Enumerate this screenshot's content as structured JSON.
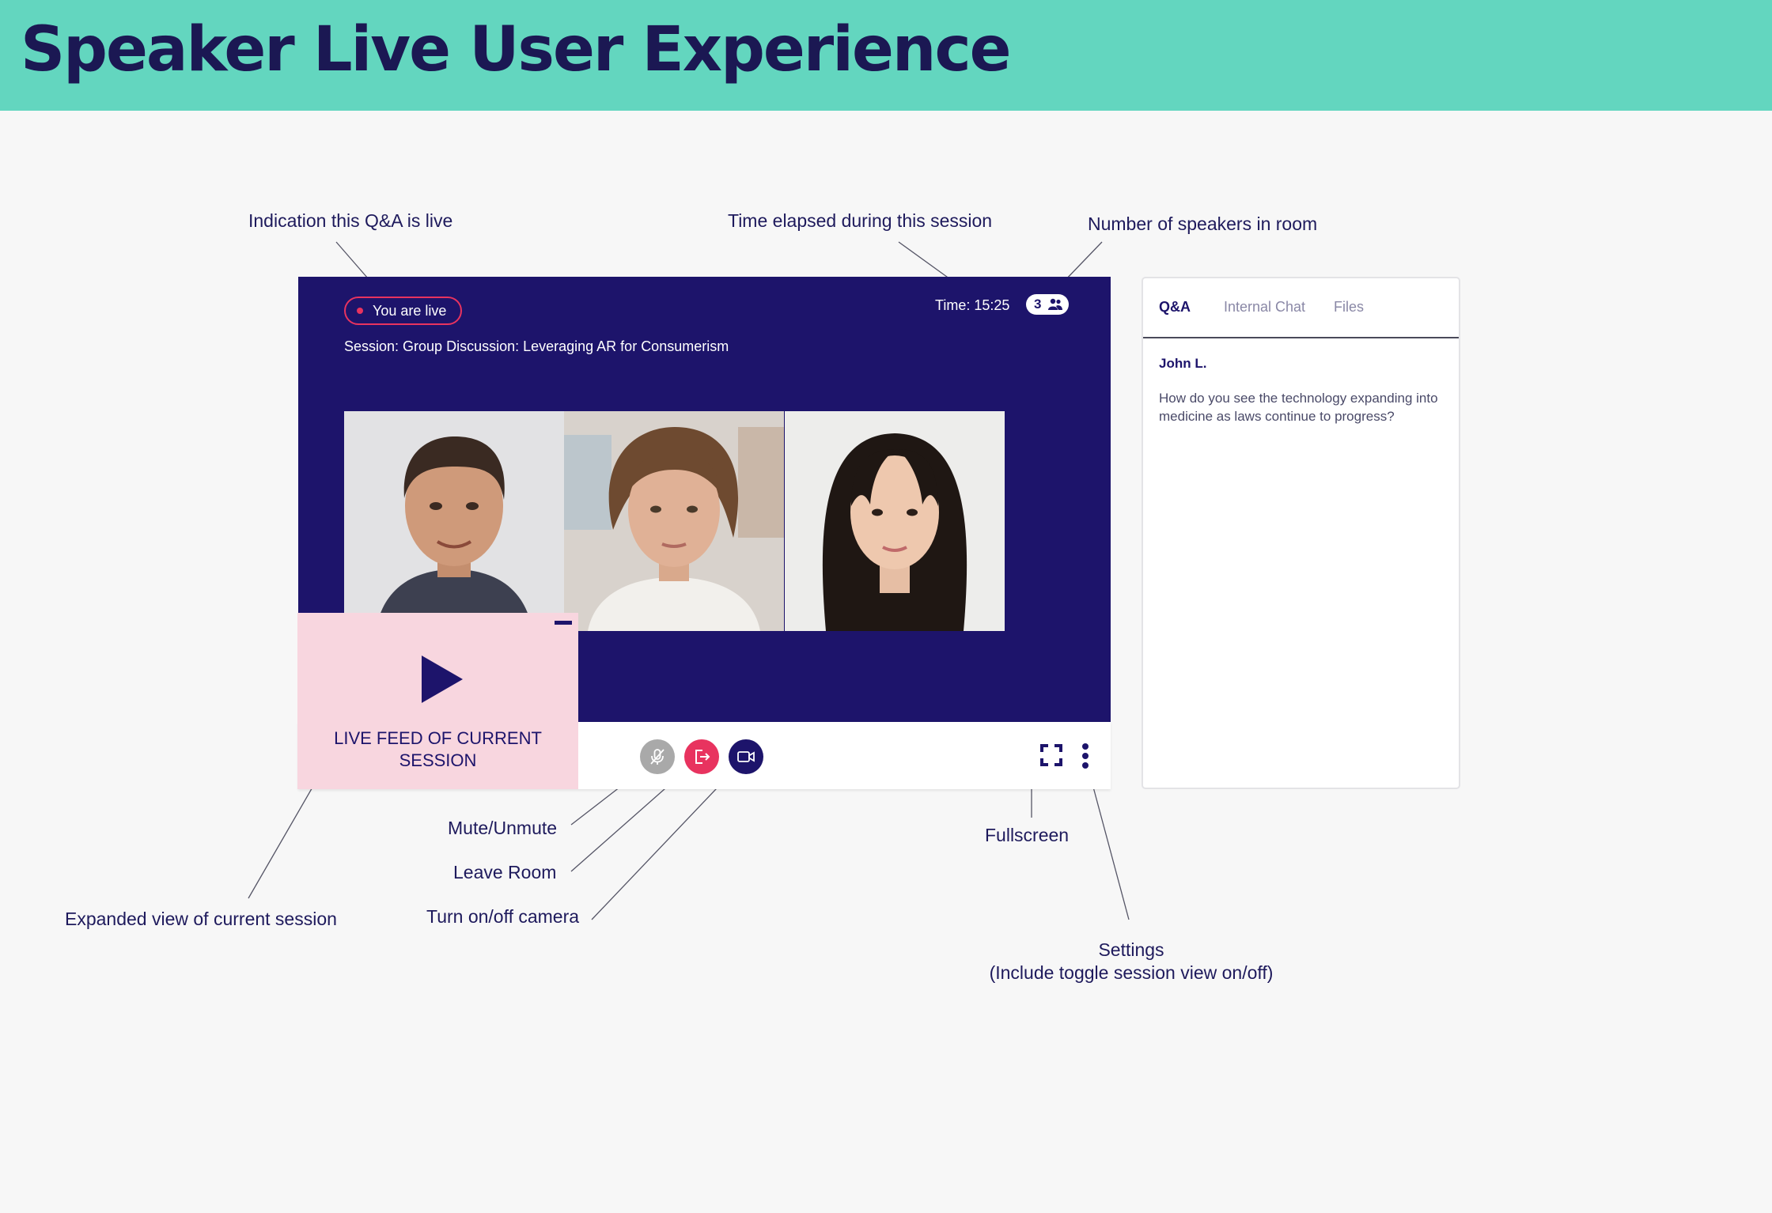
{
  "header": {
    "title": "Speaker Live User Experience"
  },
  "annotations": {
    "live_indicator": "Indication this Q&A is live",
    "time_elapsed": "Time elapsed during this session",
    "speaker_count": "Number of speakers in room",
    "mute": "Mute/Unmute",
    "leave": "Leave Room",
    "camera": "Turn on/off camera",
    "expanded_view": "Expanded view of current session",
    "fullscreen": "Fullscreen",
    "settings_line1": "Settings",
    "settings_line2": "(Include toggle session view on/off)"
  },
  "stage": {
    "live_label": "You are live",
    "session_title": "Session: Group Discussion: Leveraging AR for Consumerism",
    "timer": "Time: 15:25",
    "speaker_count": "3",
    "speakers": [
      "speaker-1",
      "speaker-2",
      "speaker-3"
    ]
  },
  "pip": {
    "label": "LIVE FEED OF CURRENT SESSION"
  },
  "controls": {
    "mute_color": "#a9a9a9",
    "leave_color": "#e8335f",
    "camera_color": "#1d146b",
    "icons": [
      "microphone-off-icon",
      "exit-icon",
      "video-camera-icon",
      "fullscreen-icon",
      "more-vertical-icon"
    ]
  },
  "panel": {
    "tabs": [
      "Q&A",
      "Internal Chat",
      "Files"
    ],
    "question": {
      "author": "John L.",
      "text": "How do you see the technology expanding into medicine as laws continue to progress?"
    }
  },
  "colors": {
    "accent": "#63d6bf",
    "navy": "#1d146b",
    "live_red": "#e8335f",
    "pip_pink": "#f8d6df"
  }
}
